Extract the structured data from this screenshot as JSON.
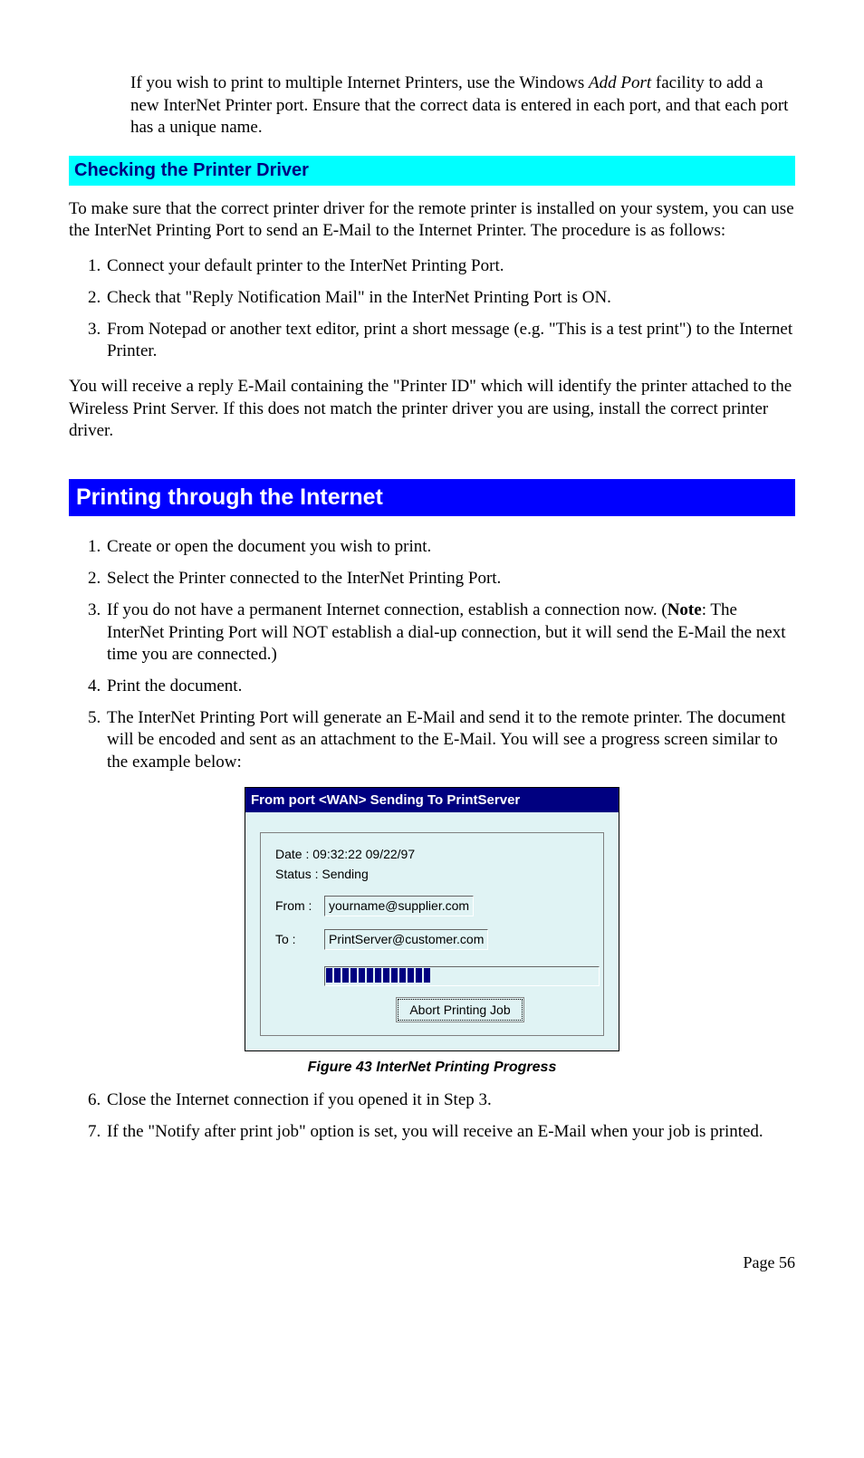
{
  "intro_indent": {
    "pre": "If you wish to print to multiple Internet Printers, use the Windows ",
    "ital": "Add Port",
    "post": " facility to add a new InterNet Printer port. Ensure that the correct data is entered in each port, and that each port has a unique name."
  },
  "subheading": "Checking the Printer Driver",
  "para1": "To make sure that the correct printer driver for the remote printer is installed on your system, you can use the InterNet Printing Port to send an E-Mail to the Internet Printer. The procedure is as follows:",
  "list1": [
    "Connect your default printer to the InterNet Printing Port.",
    "Check that \"Reply Notification Mail\" in the InterNet Printing Port is ON.",
    "From Notepad or another text editor, print a short message (e.g. \"This is a test print\") to the Internet Printer."
  ],
  "para2": "You will receive a reply E-Mail containing the \"Printer ID\" which will identify the printer attached to the Wireless Print Server. If this does not match the printer driver you are using, install the correct printer driver.",
  "main_heading": "Printing through the Internet",
  "list2a": [
    "Create or open the document you wish to print.",
    "Select the Printer connected to the InterNet Printing Port."
  ],
  "list2_item3": {
    "pre": "If you do not have a permanent Internet connection, establish a connection now. (",
    "bold": "Note",
    "post": ": The InterNet Printing Port will NOT establish a dial-up connection, but it will send the E-Mail the next time you are connected.)"
  },
  "list2b": [
    "Print the document.",
    "The InterNet Printing Port will generate an E-Mail and send it to the remote printer. The document will be encoded and sent as an attachment to the E-Mail. You will see a progress screen similar to the example below:"
  ],
  "dialog": {
    "title": "From port <WAN> Sending To PrintServer",
    "date_label": "Date : 09:32:22 09/22/97",
    "status_label": "Status : Sending",
    "from_label": "From :",
    "from_value": "yourname@supplier.com",
    "to_label": "To :",
    "to_value": "PrintServer@customer.com",
    "progress_segments": 13,
    "abort_label": "Abort Printing Job"
  },
  "caption": "Figure 43 InterNet Printing Progress",
  "list2c": [
    "Close the Internet connection if you opened it in Step 3.",
    "If the \"Notify after print job\" option is set, you will receive an E-Mail when your job is printed."
  ],
  "page_number": "Page 56"
}
